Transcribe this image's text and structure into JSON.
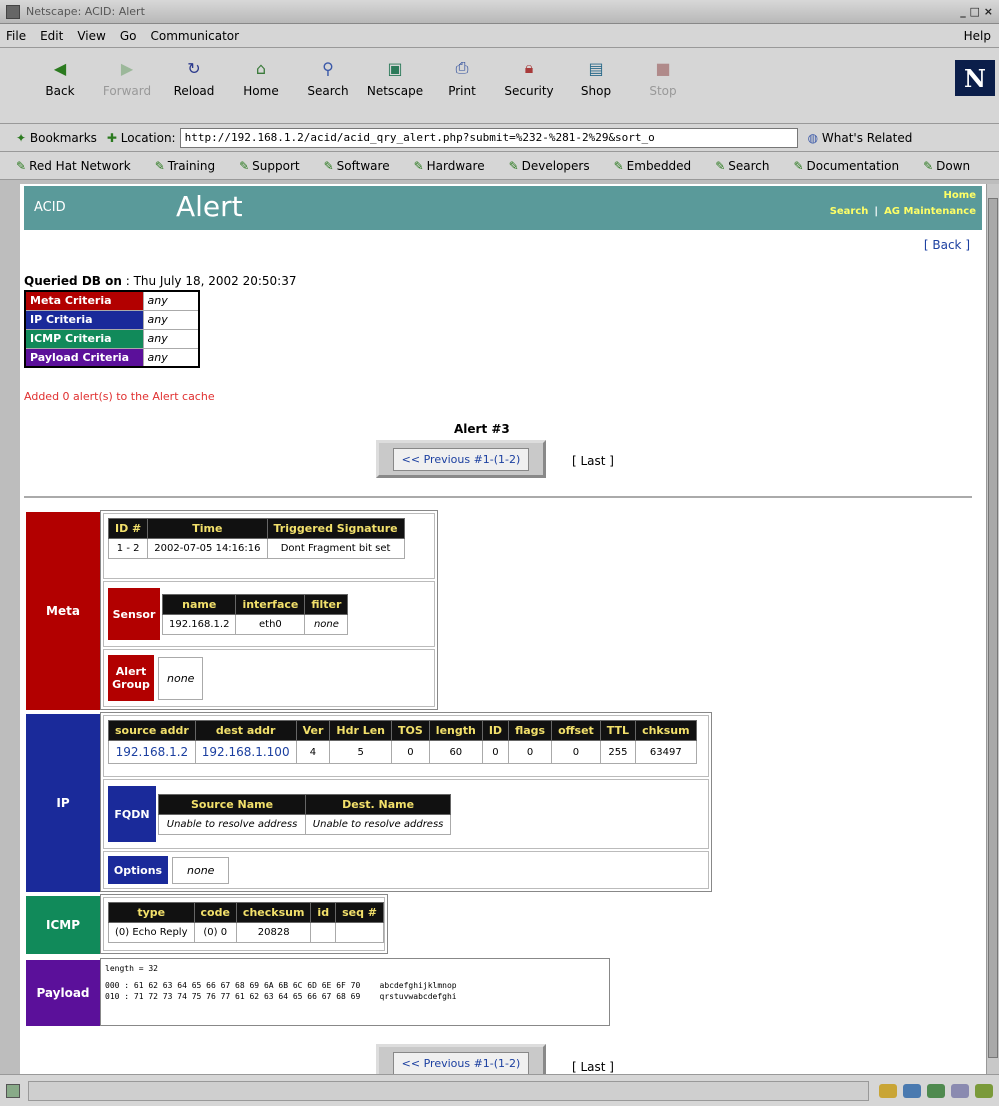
{
  "window": {
    "title": "Netscape: ACID: Alert",
    "controls": "_ □ ×"
  },
  "menu": [
    "File",
    "Edit",
    "View",
    "Go",
    "Communicator"
  ],
  "menu_help": "Help",
  "toolbar": [
    {
      "label": "Back",
      "icon": "back-icon"
    },
    {
      "label": "Forward",
      "icon": "forward-icon",
      "disabled": true
    },
    {
      "label": "Reload",
      "icon": "reload-icon"
    },
    {
      "label": "Home",
      "icon": "home-icon"
    },
    {
      "label": "Search",
      "icon": "search-icon"
    },
    {
      "label": "Netscape",
      "icon": "netscape-icon"
    },
    {
      "label": "Print",
      "icon": "print-icon"
    },
    {
      "label": "Security",
      "icon": "security-icon"
    },
    {
      "label": "Shop",
      "icon": "shop-icon"
    },
    {
      "label": "Stop",
      "icon": "stop-icon",
      "disabled": true
    }
  ],
  "logo": "N",
  "location": {
    "bookmarks": "Bookmarks",
    "label": "Location:",
    "url": "http://192.168.1.2/acid/acid_qry_alert.php?submit=%232-%281-2%29&sort_o",
    "related": "What's Related"
  },
  "personal_toolbar": [
    "Red Hat Network",
    "Training",
    "Support",
    "Software",
    "Hardware",
    "Developers",
    "Embedded",
    "Search",
    "Documentation",
    "Down"
  ],
  "acid": {
    "brand": "ACID",
    "title": "Alert",
    "nav_home": "Home",
    "nav_search": "Search",
    "nav_sep": "|",
    "nav_maint": "AG Maintenance",
    "back": "[ Back ]"
  },
  "query": {
    "queried_label": "Queried DB on",
    "queried_value": " : Thu July 18, 2002 20:50:37",
    "criteria": [
      {
        "label": "Meta Criteria",
        "value": "any",
        "color": "#b20000"
      },
      {
        "label": "IP Criteria",
        "value": "any",
        "color": "#1a2a9a"
      },
      {
        "label": "ICMP Criteria",
        "value": "any",
        "color": "#118a5a"
      },
      {
        "label": "Payload Criteria",
        "value": "any",
        "color": "#5b109a"
      }
    ],
    "added": "Added 0 alert(s) to the Alert cache"
  },
  "nav": {
    "alert_no": "Alert #3",
    "previous": "<< Previous #1-(1-2)",
    "last": "[ Last ]"
  },
  "meta": {
    "label": "Meta",
    "headers": [
      "ID #",
      "Time",
      "Triggered Signature"
    ],
    "row": [
      "1 - 2",
      "2002-07-05 14:16:16",
      "Dont Fragment bit set"
    ],
    "sensor": {
      "label": "Sensor",
      "headers": [
        "name",
        "interface",
        "filter"
      ],
      "row": [
        "192.168.1.2",
        "eth0",
        "none"
      ]
    },
    "alert_group": {
      "label": "Alert Group",
      "value": "none"
    }
  },
  "ip": {
    "label": "IP",
    "headers": [
      "source addr",
      "dest addr",
      "Ver",
      "Hdr Len",
      "TOS",
      "length",
      "ID",
      "flags",
      "offset",
      "TTL",
      "chksum"
    ],
    "row": [
      "192.168.1.2",
      "192.168.1.100",
      "4",
      "5",
      "0",
      "60",
      "0",
      "0",
      "0",
      "255",
      "63497"
    ],
    "fqdn": {
      "label": "FQDN",
      "headers": [
        "Source Name",
        "Dest. Name"
      ],
      "row": [
        "Unable to resolve address",
        "Unable to resolve address"
      ]
    },
    "options": {
      "label": "Options",
      "value": "none"
    }
  },
  "icmp": {
    "label": "ICMP",
    "headers": [
      "type",
      "code",
      "checksum",
      "id",
      "seq #"
    ],
    "row": [
      "(0) Echo Reply",
      "(0) 0",
      "20828",
      "",
      ""
    ]
  },
  "payload": {
    "label": "Payload",
    "length": "length = 32",
    "line1": "000 : 61 62 63 64 65 66 67 68 69 6A 6B 6C 6D 6E 6F 70    abcdefghijklmnop",
    "line2": "010 : 71 72 73 74 75 76 77 61 62 63 64 65 66 67 68 69    qrstuvwabcdefghi"
  },
  "nav_bottom": {
    "previous": "<< Previous #1-(1-2)",
    "last": "[ Last ]"
  },
  "colors": {
    "meta": "#b20000",
    "ip": "#1a2a9a",
    "icmp": "#118a5a",
    "payload": "#5b109a",
    "header_teal": "#5a9a9a"
  }
}
